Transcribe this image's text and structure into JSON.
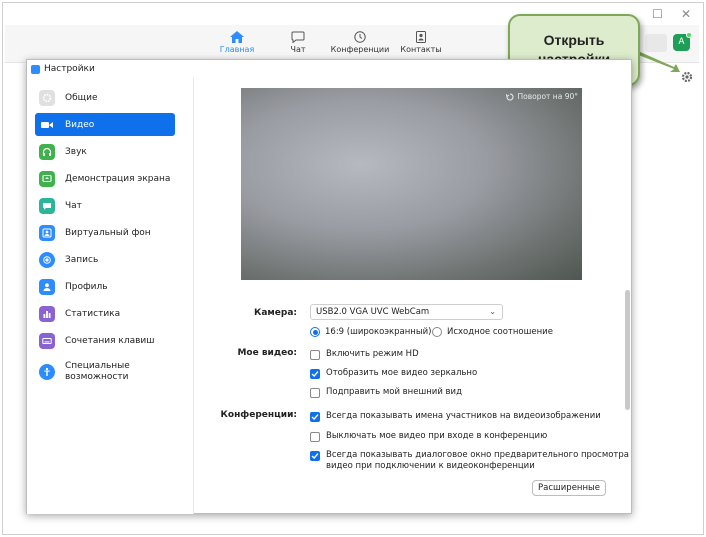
{
  "main_window": {
    "controls": [
      "☐",
      "✕"
    ],
    "nav": [
      {
        "label": "Главная",
        "icon": "home-icon",
        "active": true
      },
      {
        "label": "Чат",
        "icon": "chat-icon",
        "active": false
      },
      {
        "label": "Конференции",
        "icon": "clock-icon",
        "active": false
      },
      {
        "label": "Контакты",
        "icon": "contacts-icon",
        "active": false
      }
    ],
    "avatar_letter": "A"
  },
  "callout": {
    "line1": "Открыть",
    "line2": "настройки"
  },
  "settings": {
    "title": "Настройки",
    "sidebar": [
      {
        "label": "Общие",
        "icon": "gear-icon",
        "color": "#e0e0e0"
      },
      {
        "label": "Видео",
        "icon": "video-icon",
        "color": "#ffffff",
        "active": true
      },
      {
        "label": "Звук",
        "icon": "headphones-icon",
        "color": "#3fb24c"
      },
      {
        "label": "Демонстрация экрана",
        "icon": "screen-share-icon",
        "color": "#3fb24c"
      },
      {
        "label": "Чат",
        "icon": "chat-icon",
        "color": "#2bb59a"
      },
      {
        "label": "Виртуальный фон",
        "icon": "portrait-icon",
        "color": "#2d8cff"
      },
      {
        "label": "Запись",
        "icon": "record-icon",
        "color": "#2d8cff"
      },
      {
        "label": "Профиль",
        "icon": "profile-icon",
        "color": "#2d8cff"
      },
      {
        "label": "Статистика",
        "icon": "stats-icon",
        "color": "#8a63d2"
      },
      {
        "label": "Сочетания клавиш",
        "icon": "keyboard-icon",
        "color": "#8a63d2"
      },
      {
        "label1": "Специальные",
        "label2": "возможности",
        "icon": "accessibility-icon",
        "color": "#2d8cff"
      }
    ],
    "video": {
      "rotate_label": "Поворот на 90°",
      "camera_label": "Камера:",
      "camera_value": "USB2.0 VGA UVC WebCam",
      "ratio_169": "16:9 (широкоэкранный)",
      "ratio_original": "Исходное соотношение",
      "my_video_label": "Мое видео:",
      "hd": "Включить режим HD",
      "mirror": "Отобразить мое видео зеркально",
      "touchup": "Подправить мой внешний вид",
      "meetings_label": "Конференции:",
      "show_names": "Всегда показывать имена участников на видеоизображении",
      "turn_off": "Выключать мое видео при входе в конференцию",
      "preview_line1": "Всегда показывать диалоговое окно предварительного просмотра",
      "preview_line2": "видео при подключении к видеоконференции",
      "advanced": "Расширенные"
    }
  }
}
